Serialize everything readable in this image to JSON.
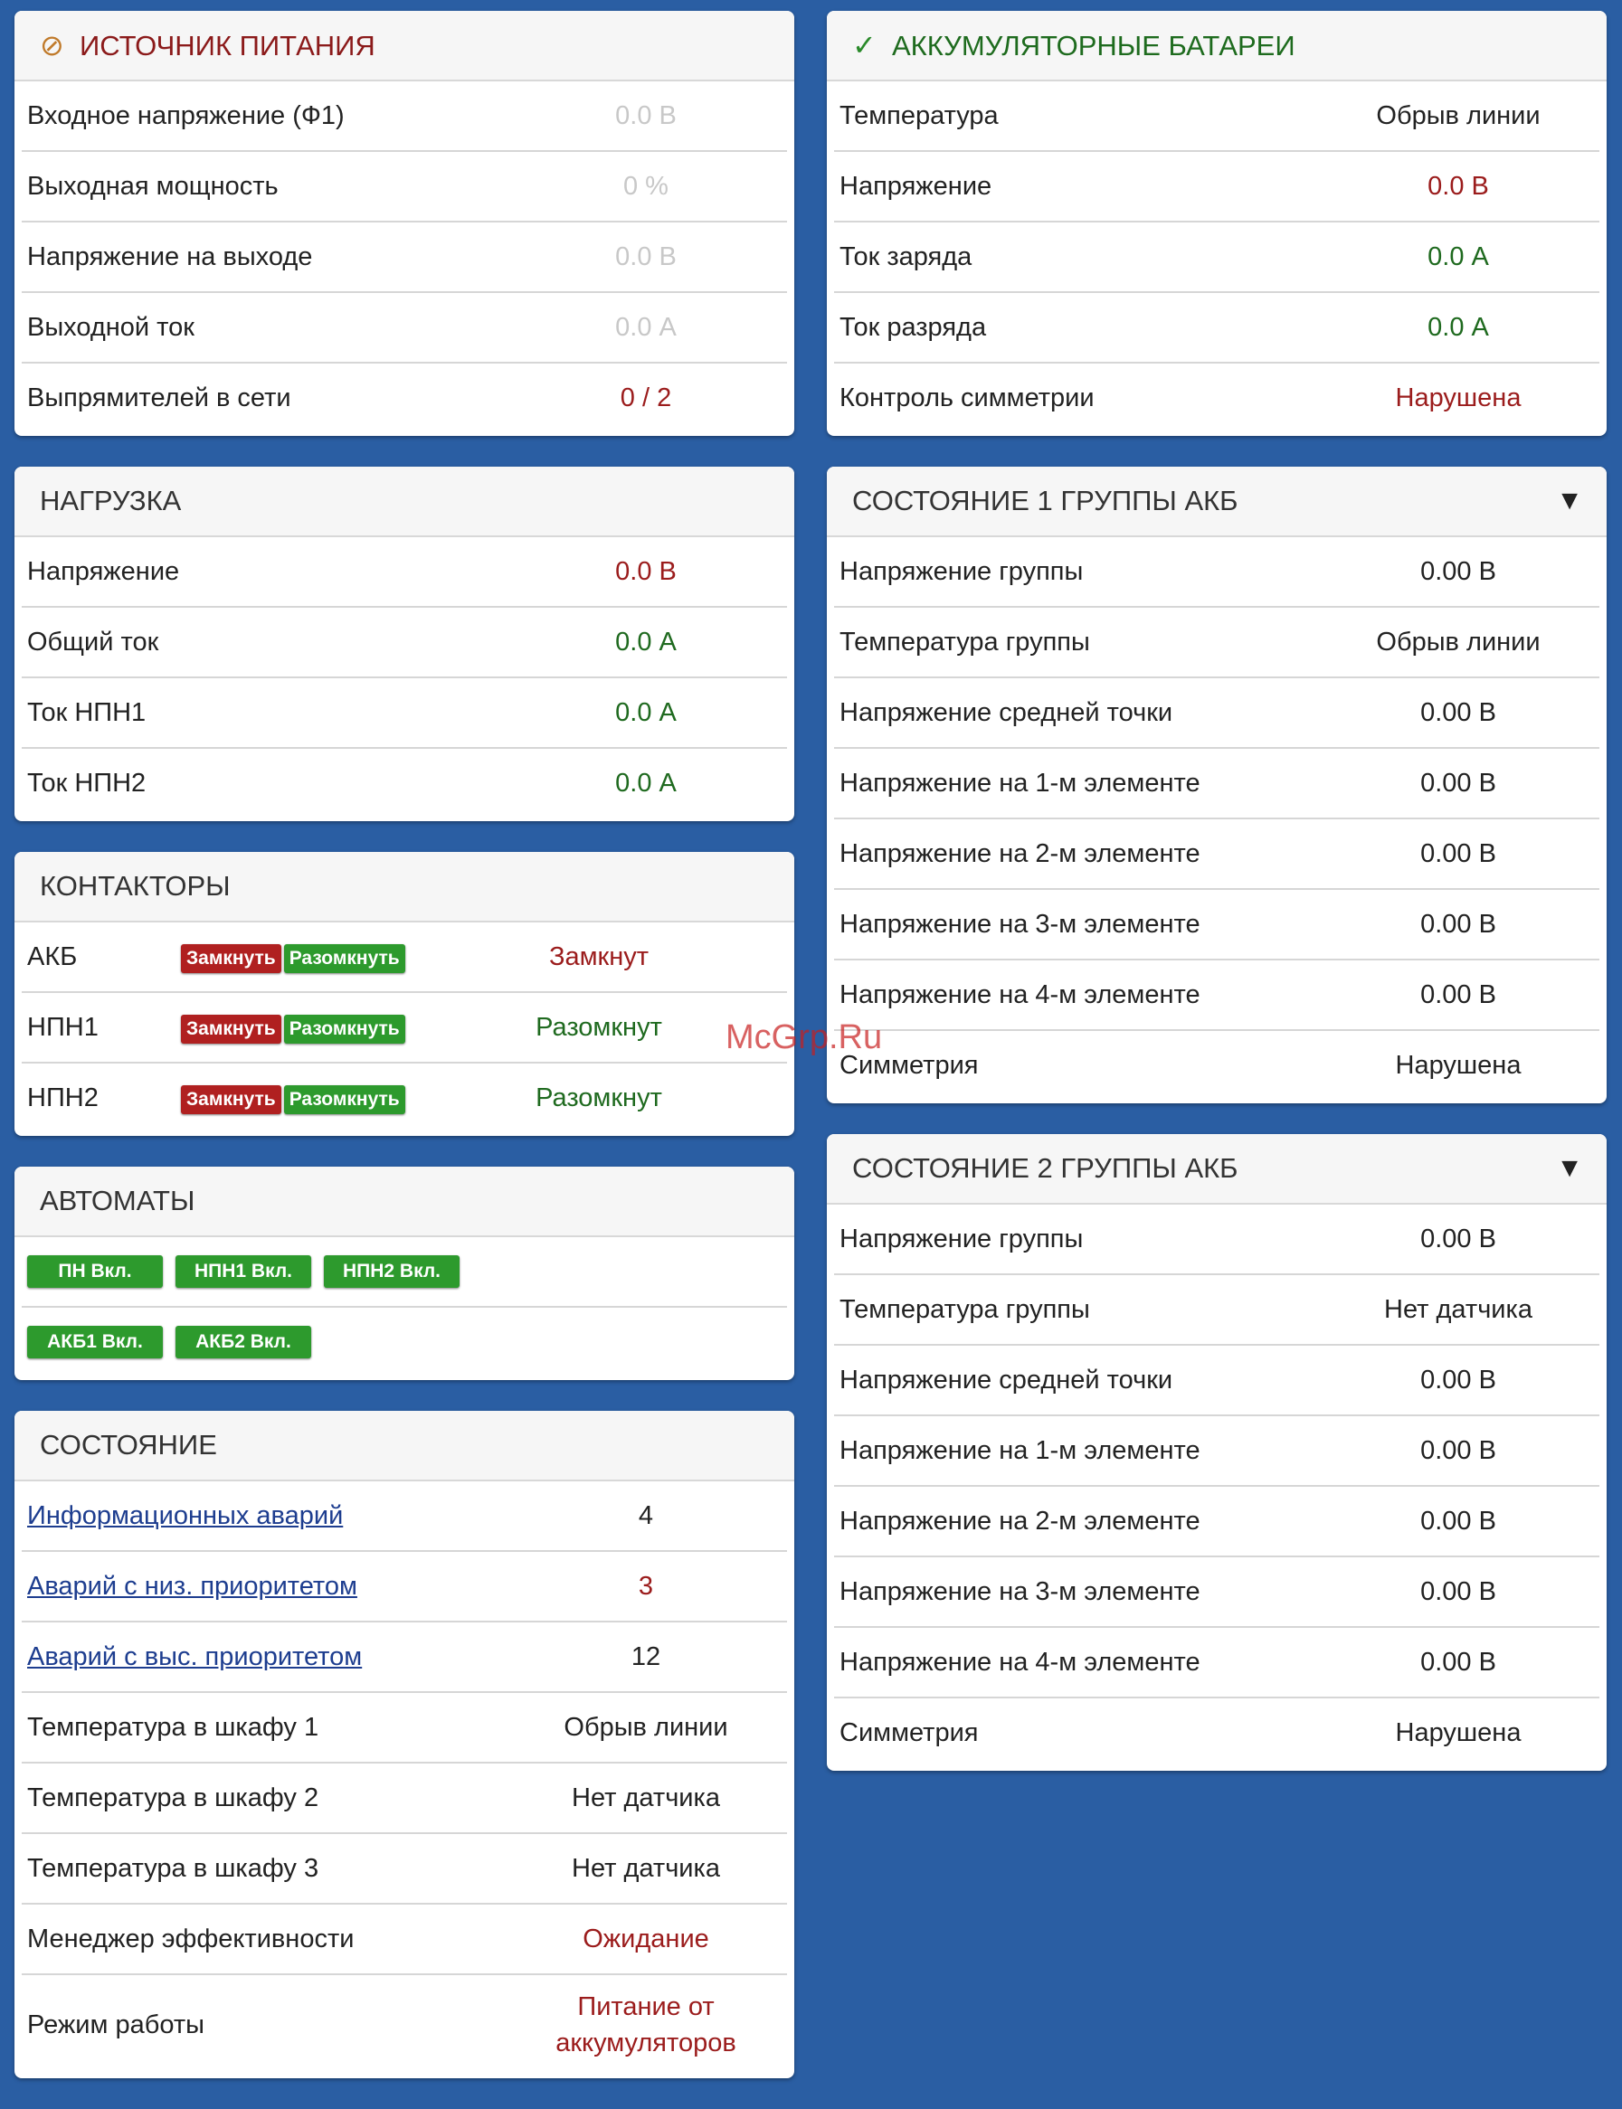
{
  "power": {
    "title": "ИСТОЧНИК ПИТАНИЯ",
    "rows": [
      {
        "label": "Входное напряжение (Ф1)",
        "value": "0.0 В"
      },
      {
        "label": "Выходная мощность",
        "value": "0 %"
      },
      {
        "label": "Напряжение на выходе",
        "value": "0.0 В"
      },
      {
        "label": "Выходной ток",
        "value": "0.0 А"
      },
      {
        "label": "Выпрямителей в сети",
        "value": "0 / 2"
      }
    ]
  },
  "load": {
    "title": "НАГРУЗКА",
    "rows": [
      {
        "label": "Напряжение",
        "value": "0.0 В"
      },
      {
        "label": "Общий ток",
        "value": "0.0 А"
      },
      {
        "label": "Ток НПН1",
        "value": "0.0 А"
      },
      {
        "label": "Ток НПН2",
        "value": "0.0 А"
      }
    ]
  },
  "contactors": {
    "title": "КОНТАКТОРЫ",
    "close_label": "Замкнуть",
    "open_label": "Разомкнуть",
    "rows": [
      {
        "label": "АКБ",
        "value": "Замкнут"
      },
      {
        "label": "НПН1",
        "value": "Разомкнут"
      },
      {
        "label": "НПН2",
        "value": "Разомкнут"
      }
    ]
  },
  "breakers": {
    "title": "АВТОМАТЫ",
    "buttons": [
      "ПН Вкл.",
      "НПН1 Вкл.",
      "НПН2 Вкл.",
      "АКБ1 Вкл.",
      "АКБ2 Вкл."
    ]
  },
  "state": {
    "title": "СОСТОЯНИЕ",
    "rows": [
      {
        "label": "Информационных аварий",
        "value": "4"
      },
      {
        "label": "Аварий с низ. приоритетом",
        "value": "3"
      },
      {
        "label": "Аварий с выс. приоритетом",
        "value": "12"
      },
      {
        "label": "Температура в шкафу 1",
        "value": "Обрыв линии"
      },
      {
        "label": "Температура в шкафу 2",
        "value": "Нет датчика"
      },
      {
        "label": "Температура в шкафу 3",
        "value": "Нет датчика"
      },
      {
        "label": "Менеджер эффективности",
        "value": "Ожидание"
      },
      {
        "label": "Режим работы",
        "value_line1": "Питание от",
        "value_line2": "аккумуляторов"
      }
    ]
  },
  "batteries": {
    "title": "АККУМУЛЯТОРНЫЕ БАТАРЕИ",
    "rows": [
      {
        "label": "Температура",
        "value": "Обрыв линии"
      },
      {
        "label": "Напряжение",
        "value": "0.0 В"
      },
      {
        "label": "Ток заряда",
        "value": "0.0 А"
      },
      {
        "label": "Ток разряда",
        "value": "0.0 А"
      },
      {
        "label": "Контроль симметрии",
        "value": "Нарушена"
      }
    ]
  },
  "group1": {
    "title": "СОСТОЯНИЕ 1 ГРУППЫ АКБ",
    "caret": "▼",
    "rows": [
      {
        "label": "Напряжение группы",
        "value": "0.00 В"
      },
      {
        "label": "Температура группы",
        "value": "Обрыв линии"
      },
      {
        "label": "Напряжение средней точки",
        "value": "0.00 В"
      },
      {
        "label": "Напряжение на 1-м элементе",
        "value": "0.00 В"
      },
      {
        "label": "Напряжение на 2-м элементе",
        "value": "0.00 В"
      },
      {
        "label": "Напряжение на 3-м элементе",
        "value": "0.00 В"
      },
      {
        "label": "Напряжение на 4-м элементе",
        "value": "0.00 В"
      },
      {
        "label": "Симметрия",
        "value": "Нарушена"
      }
    ]
  },
  "group2": {
    "title": "СОСТОЯНИЕ 2 ГРУППЫ АКБ",
    "caret": "▼",
    "rows": [
      {
        "label": "Напряжение группы",
        "value": "0.00 В"
      },
      {
        "label": "Температура группы",
        "value": "Нет датчика"
      },
      {
        "label": "Напряжение средней точки",
        "value": "0.00 В"
      },
      {
        "label": "Напряжение на 1-м элементе",
        "value": "0.00 В"
      },
      {
        "label": "Напряжение на 2-м элементе",
        "value": "0.00 В"
      },
      {
        "label": "Напряжение на 3-м элементе",
        "value": "0.00 В"
      },
      {
        "label": "Напряжение на 4-м элементе",
        "value": "0.00 В"
      },
      {
        "label": "Симметрия",
        "value": "Нарушена"
      }
    ]
  },
  "watermark": "McGrp.Ru",
  "icons": {
    "power": "no-entry-icon",
    "batteries": "check-icon",
    "caret": "caret-down-icon"
  },
  "colors": {
    "background": "#2a5ea3",
    "alarm_red": "#9b1c1c",
    "ok_green": "#1f6a1f",
    "button_green": "#2d9a2d",
    "button_red": "#b02020"
  }
}
